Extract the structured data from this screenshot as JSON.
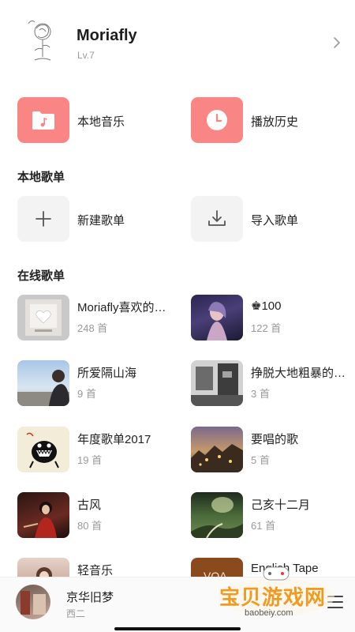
{
  "profile": {
    "username": "Moriafly",
    "level": "Lv.7"
  },
  "quick_actions": [
    {
      "label": "本地音乐",
      "icon": "music-folder-icon"
    },
    {
      "label": "播放历史",
      "icon": "clock-icon"
    }
  ],
  "local_section": {
    "title": "本地歌单",
    "items": [
      {
        "label": "新建歌单",
        "icon": "plus-icon"
      },
      {
        "label": "导入歌单",
        "icon": "download-icon"
      }
    ]
  },
  "online_section": {
    "title": "在线歌单",
    "playlists": [
      {
        "name": "Moriafly喜欢的音乐",
        "count": "248 首"
      },
      {
        "name": "♚100",
        "count": "122 首"
      },
      {
        "name": "所爱隔山海",
        "count": "9 首"
      },
      {
        "name": "挣脱大地粗暴的束缚",
        "count": "3 首"
      },
      {
        "name": "年度歌单2017",
        "count": "19 首"
      },
      {
        "name": "要唱的歌",
        "count": "5 首"
      },
      {
        "name": "古风",
        "count": "80 首"
      },
      {
        "name": "己亥十二月",
        "count": "61 首"
      },
      {
        "name": "轻音乐",
        "count": ""
      },
      {
        "name": "English Tape",
        "count": ""
      }
    ]
  },
  "player": {
    "title": "京华旧梦",
    "artist": "西二"
  },
  "watermark": {
    "text": "宝贝游戏网",
    "url": "baobeiy.com",
    "voa": "VOA"
  },
  "colors": {
    "accent": "#fa8585",
    "tile_gray": "#f3f3f3",
    "watermark": "#f29a1f"
  }
}
